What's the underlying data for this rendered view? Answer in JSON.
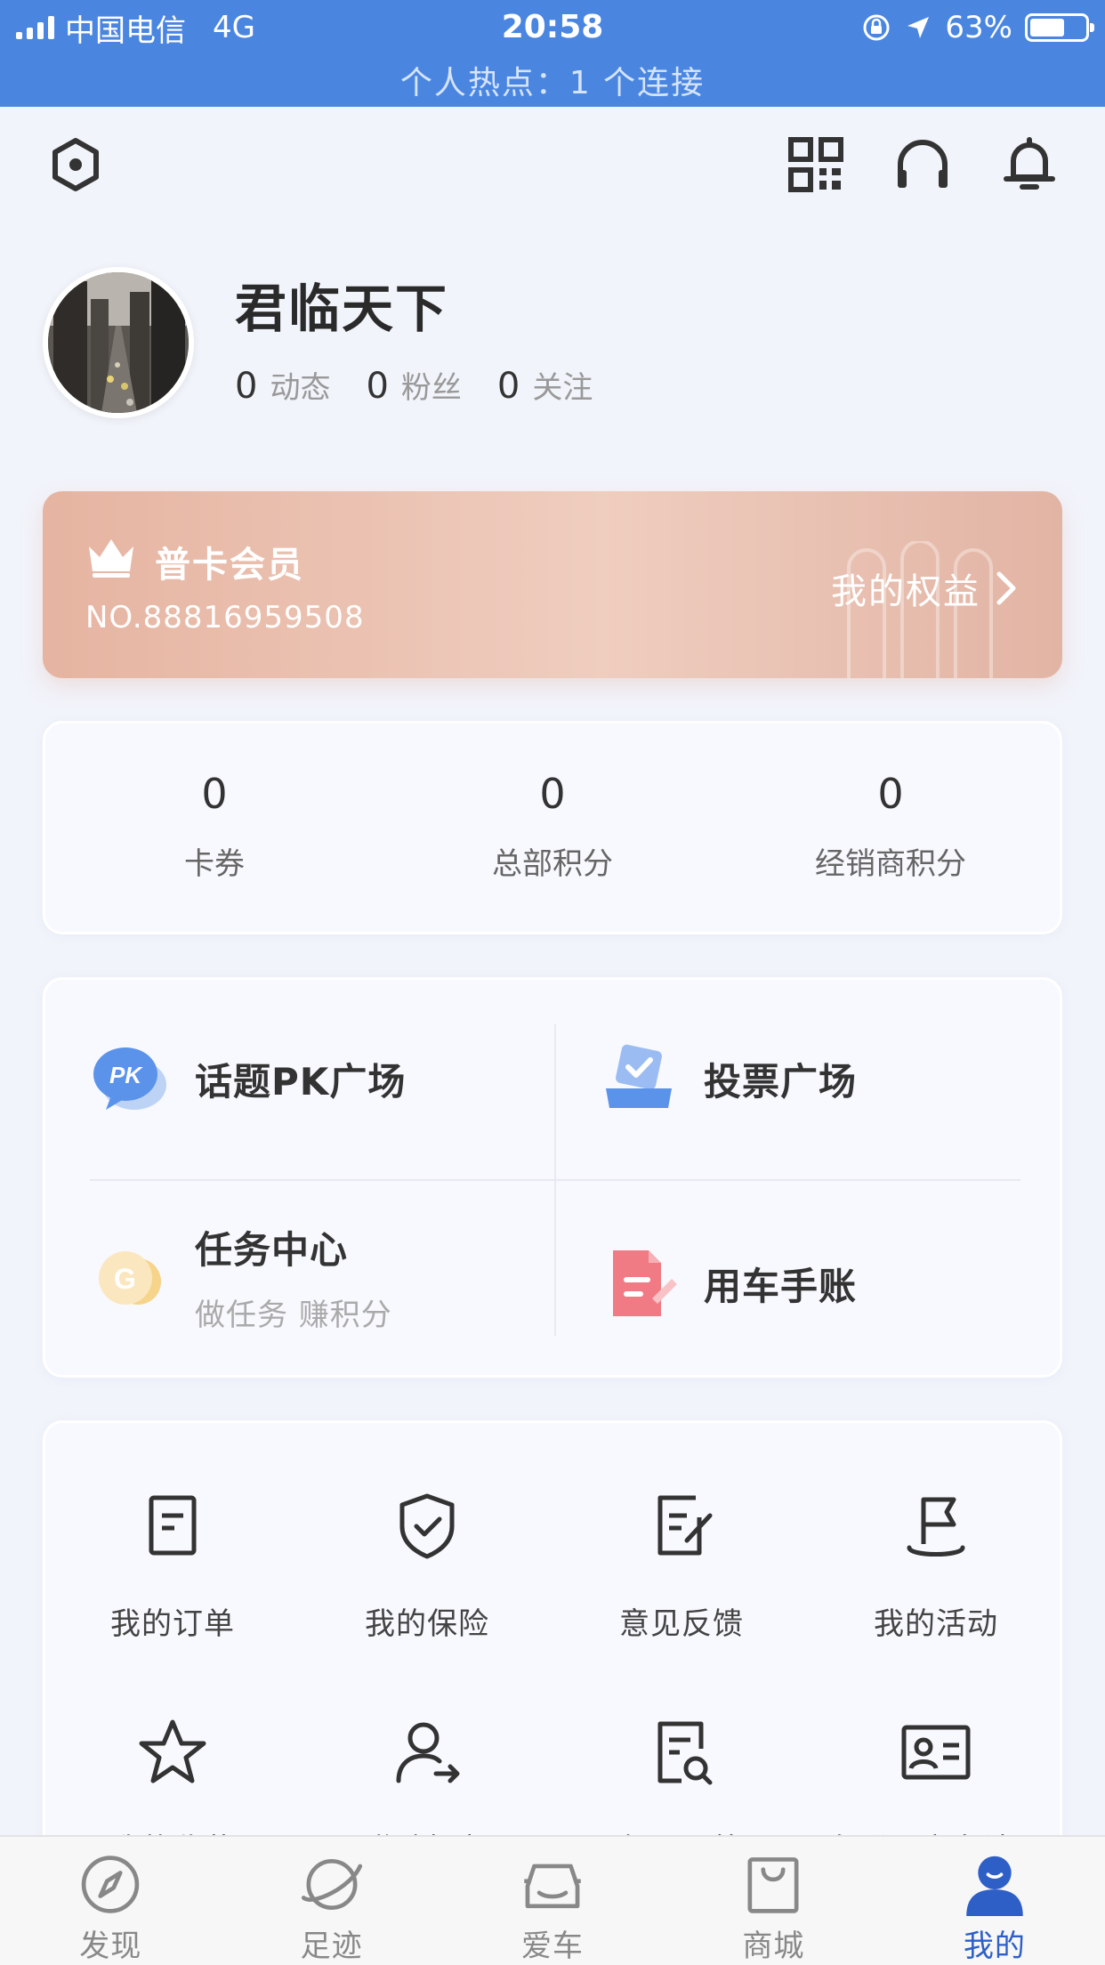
{
  "status_bar": {
    "carrier": "中国电信",
    "network": "4G",
    "time": "20:58",
    "battery": "63%",
    "battery_level": 0.63,
    "hotspot": "个人热点：1 个连接"
  },
  "header_icons": [
    "settings-hexagon-icon",
    "qr-code-icon",
    "headset-icon",
    "bell-icon"
  ],
  "profile": {
    "name": "君临天下",
    "stats": [
      {
        "value": "0",
        "label": "动态"
      },
      {
        "value": "0",
        "label": "粉丝"
      },
      {
        "value": "0",
        "label": "关注"
      }
    ]
  },
  "membership": {
    "title": "普卡会员",
    "number": "NO.88816959508",
    "link": "我的权益"
  },
  "points": [
    {
      "value": "0",
      "label": "卡券"
    },
    {
      "value": "0",
      "label": "总部积分"
    },
    {
      "value": "0",
      "label": "经销商积分"
    }
  ],
  "features": [
    {
      "title": "话题PK广场",
      "subtitle": "",
      "icon": "pk-chat-icon"
    },
    {
      "title": "投票广场",
      "subtitle": "",
      "icon": "vote-box-icon"
    },
    {
      "title": "任务中心",
      "subtitle": "做任务 赚积分",
      "icon": "coin-icon"
    },
    {
      "title": "用车手账",
      "subtitle": "",
      "icon": "notebook-icon"
    }
  ],
  "services": [
    {
      "label": "我的订单",
      "icon": "order-icon"
    },
    {
      "label": "我的保险",
      "icon": "shield-check-icon"
    },
    {
      "label": "意见反馈",
      "icon": "feedback-edit-icon"
    },
    {
      "label": "我的活动",
      "icon": "flag-icon"
    },
    {
      "label": "我的收藏",
      "icon": "star-icon"
    },
    {
      "label": "邀请好友",
      "icon": "invite-user-icon"
    },
    {
      "label": "每月一箭",
      "icon": "doc-search-icon"
    },
    {
      "label": "车联网实名认证",
      "icon": "id-card-icon"
    }
  ],
  "tabs": [
    {
      "label": "发现",
      "icon": "compass-icon",
      "active": false
    },
    {
      "label": "足迹",
      "icon": "planet-icon",
      "active": false
    },
    {
      "label": "爱车",
      "icon": "car-icon",
      "active": false
    },
    {
      "label": "商城",
      "icon": "shopping-bag-icon",
      "active": false
    },
    {
      "label": "我的",
      "icon": "user-icon",
      "active": true
    }
  ],
  "colors": {
    "status_bar": "#4a86e0",
    "accent": "#2e5fc7",
    "member_card": "#e6b4a1"
  }
}
